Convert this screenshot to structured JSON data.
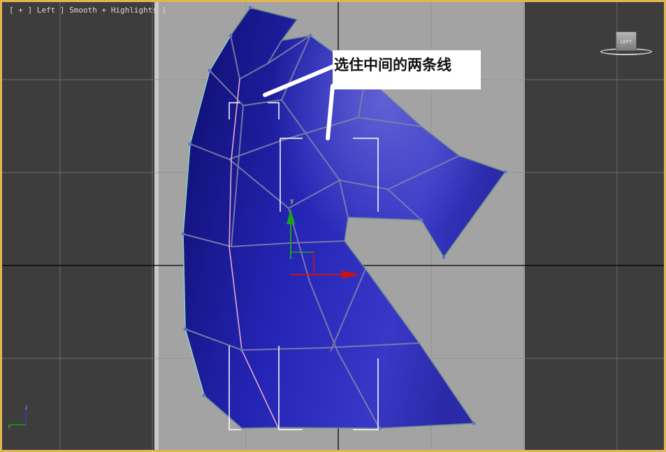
{
  "viewport": {
    "label": "[ + ] Left ] Smooth + Highlights ]",
    "border_color": "#e3b54f",
    "background_color": "#3d3d3d"
  },
  "annotation": {
    "text": "选住中间的两条线"
  },
  "viewcube": {
    "face_label": "LEFT"
  },
  "gizmo": {
    "y_label": "y"
  },
  "axis_tripod": {
    "x_label": "y",
    "y_label": "z"
  },
  "colors": {
    "mesh_fill": "#2323a8",
    "mesh_wire": "#7f7fa8",
    "reference_plane": "#a3a3a3",
    "gizmo_y": "#1aa31a",
    "gizmo_x": "#c81414"
  }
}
